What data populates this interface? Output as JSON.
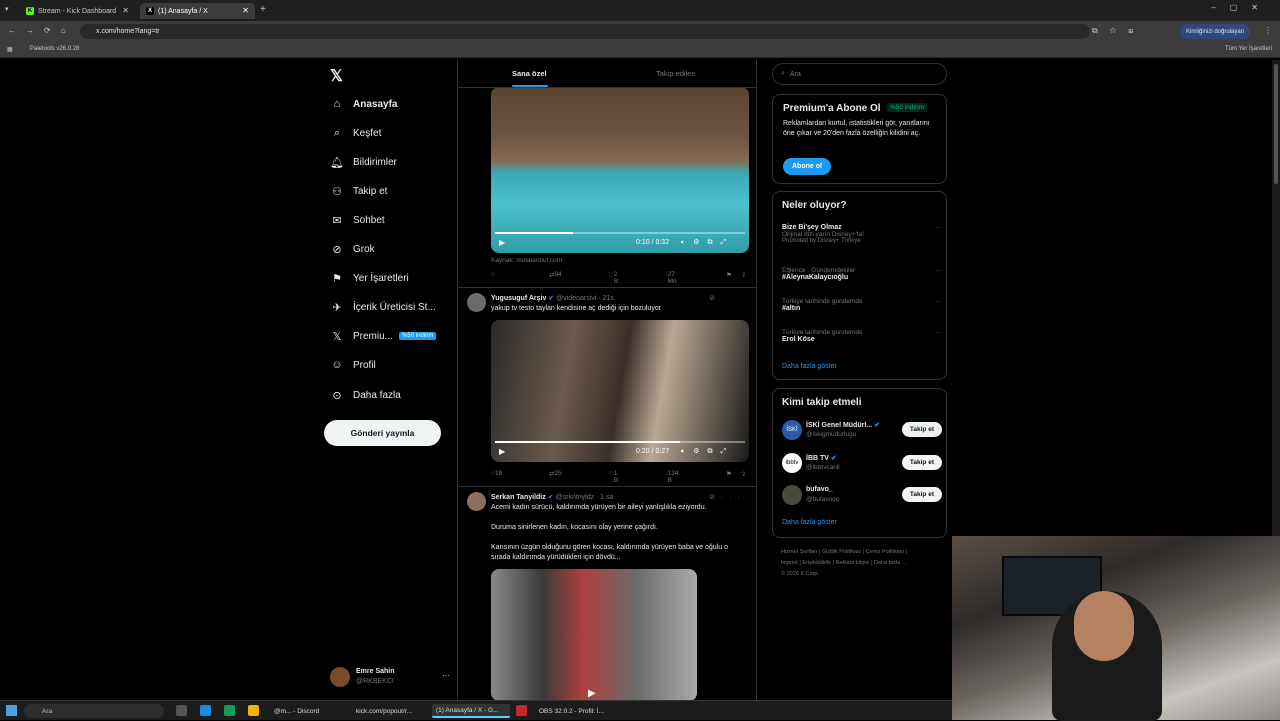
{
  "browser": {
    "tabs": [
      {
        "title": "Stream - Kick Dashboard",
        "favicon": "K"
      },
      {
        "title": "(1) Anasayfa / X",
        "favicon": "X"
      }
    ],
    "url": "x.com/home?lang=tr",
    "profile_label": "Kimliğinizi doğrulayan",
    "bookmark": "Paletools v26.0.28",
    "all_bookmarks": "Tüm Yer İşaretleri"
  },
  "sidebar": {
    "items": [
      {
        "label": "Anasayfa",
        "icon": "⌂"
      },
      {
        "label": "Keşfet",
        "icon": "⌕"
      },
      {
        "label": "Bildirimler",
        "icon": "🔔︎"
      },
      {
        "label": "Takip et",
        "icon": "⚇"
      },
      {
        "label": "Sohbet",
        "icon": "✉"
      },
      {
        "label": "Grok",
        "icon": "⊘"
      },
      {
        "label": "Yer İşaretleri",
        "icon": "⚑"
      },
      {
        "label": "İçerik Üreticisi St...",
        "icon": "✈"
      },
      {
        "label": "Premiu...",
        "icon": "𝕏"
      },
      {
        "label": "Profil",
        "icon": "☺"
      },
      {
        "label": "Daha fazla",
        "icon": "⊙"
      }
    ],
    "premium_badge": "%50 indirim",
    "post_button": "Gönderi yayınla",
    "account": {
      "name": "Emre Sahin",
      "handle": "@RKBEKCI"
    }
  },
  "timeline": {
    "tabs": {
      "for_you": "Sana özel",
      "following": "Takip edilen"
    },
    "tweet1": {
      "video_time": "0:10 / 0:32",
      "video_progress": 0.31,
      "source": "Kaynak: molatanbul.com",
      "retweets": "94",
      "likes": "2 B",
      "views": "27 Mn"
    },
    "tweet2": {
      "name": "Yugusuguf Arşiv",
      "handle": "@videoarsivi",
      "time": "21s",
      "text": "yakup tv testo taylan kendisine aç dediği için bozuluyor",
      "video_time": "0:20 / 0:27",
      "video_progress": 0.74,
      "replies": "18",
      "retweets": "25",
      "likes": "1 B",
      "views": "134 B"
    },
    "tweet3": {
      "name": "Serkan Tanyildiz",
      "handle": "@srkntnyldz",
      "time": "1 sa",
      "text1": "Acemi kadın sürücü, kaldırımda yürüyen bir aileyi yanlışlıkla eziyordu.",
      "text2": "Duruma sinirlenen kadın, kocasını olay yerine çağırdı.",
      "text3": "Karısının üzgün olduğunu gören kocası, kaldırımda yürüyen baba ve oğulu o sırada kaldırımda yürüdükleri için dövdü..."
    }
  },
  "right": {
    "search_placeholder": "Ara",
    "premium": {
      "title": "Premium'a Abone Ol",
      "badge": "%50 indirim",
      "desc": "Reklamlardan kurtul, istatistikleri gör, yanıtlarını öne çıkar ve 20'den fazla özelliğin kilidini aç.",
      "button": "Abone ol"
    },
    "trends": {
      "title": "Neler oluyor?",
      "items": [
        {
          "category": "",
          "name": "Bize Bi'şey Olmaz",
          "sub": "Orijinal dizi yarın Disney+'ta!",
          "promo": "Promoted by Disney+ Türkiye"
        },
        {
          "category": "Eğlence · Gündemdekiler",
          "name": "#AleynaKalaycıoğlu",
          "sub": "",
          "promo": ""
        },
        {
          "category": "Türkiye tarihinde gündemde",
          "name": "#altın",
          "sub": "",
          "promo": ""
        },
        {
          "category": "Türkiye tarihinde gündemde",
          "name": "Erol Köse",
          "sub": "",
          "promo": ""
        }
      ],
      "show_more": "Daha fazla göster"
    },
    "who_to_follow": {
      "title": "Kimi takip etmeli",
      "items": [
        {
          "name": "İSKİ Genel Müdürl...",
          "handle": "@iskigmudurlugu",
          "avatar": "İSKİ"
        },
        {
          "name": "İBB TV",
          "handle": "@ibbtvcanli",
          "avatar": "ibbtv"
        },
        {
          "name": "bufavo_",
          "handle": "@bufavooo",
          "avatar": ""
        }
      ],
      "button": "Takip et",
      "show_more": "Daha fazla göster"
    },
    "footer": {
      "line1": "Hizmet Şartları  |  Gizlilik Politikası  |  Çerez Politikası  |",
      "line2": "Imprint  |  Erişilebilirlik  |  Reklam bilgisi  |  Daha fazla ...",
      "line3": "© 2026 X Corp."
    }
  },
  "taskbar": {
    "search": "Ara",
    "items": [
      {
        "label": "@m... - Discord"
      },
      {
        "label": "kick.com/popout/r..."
      },
      {
        "label": "(1) Anasayfa / X -  G..."
      },
      {
        "label": "OBS 32.0.2 - Profil: İ..."
      }
    ]
  }
}
